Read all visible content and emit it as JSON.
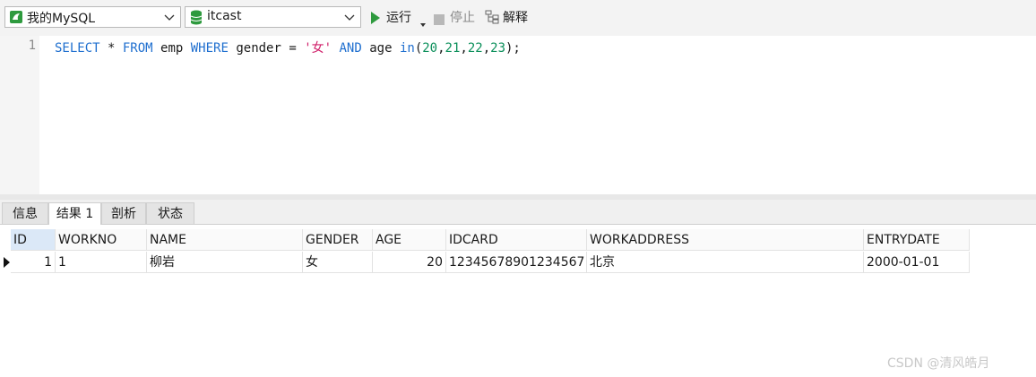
{
  "toolbar": {
    "connection": "我的MySQL",
    "database": "itcast",
    "run_label": "运行",
    "stop_label": "停止",
    "explain_label": "解释"
  },
  "editor": {
    "line_number": "1"
  },
  "tabs": [
    {
      "label": "信息"
    },
    {
      "label": "结果 1",
      "active": true
    },
    {
      "label": "剖析"
    },
    {
      "label": "状态"
    }
  ],
  "result": {
    "columns": [
      "ID",
      "WORKNO",
      "NAME",
      "GENDER",
      "AGE",
      "IDCARD",
      "WORKADDRESS",
      "ENTRYDATE"
    ],
    "rows": [
      [
        "1",
        "1",
        "柳岩",
        "女",
        "20",
        "12345678901234567",
        "北京",
        "2000-01-01"
      ]
    ]
  },
  "watermark": "CSDN @清风皓月"
}
